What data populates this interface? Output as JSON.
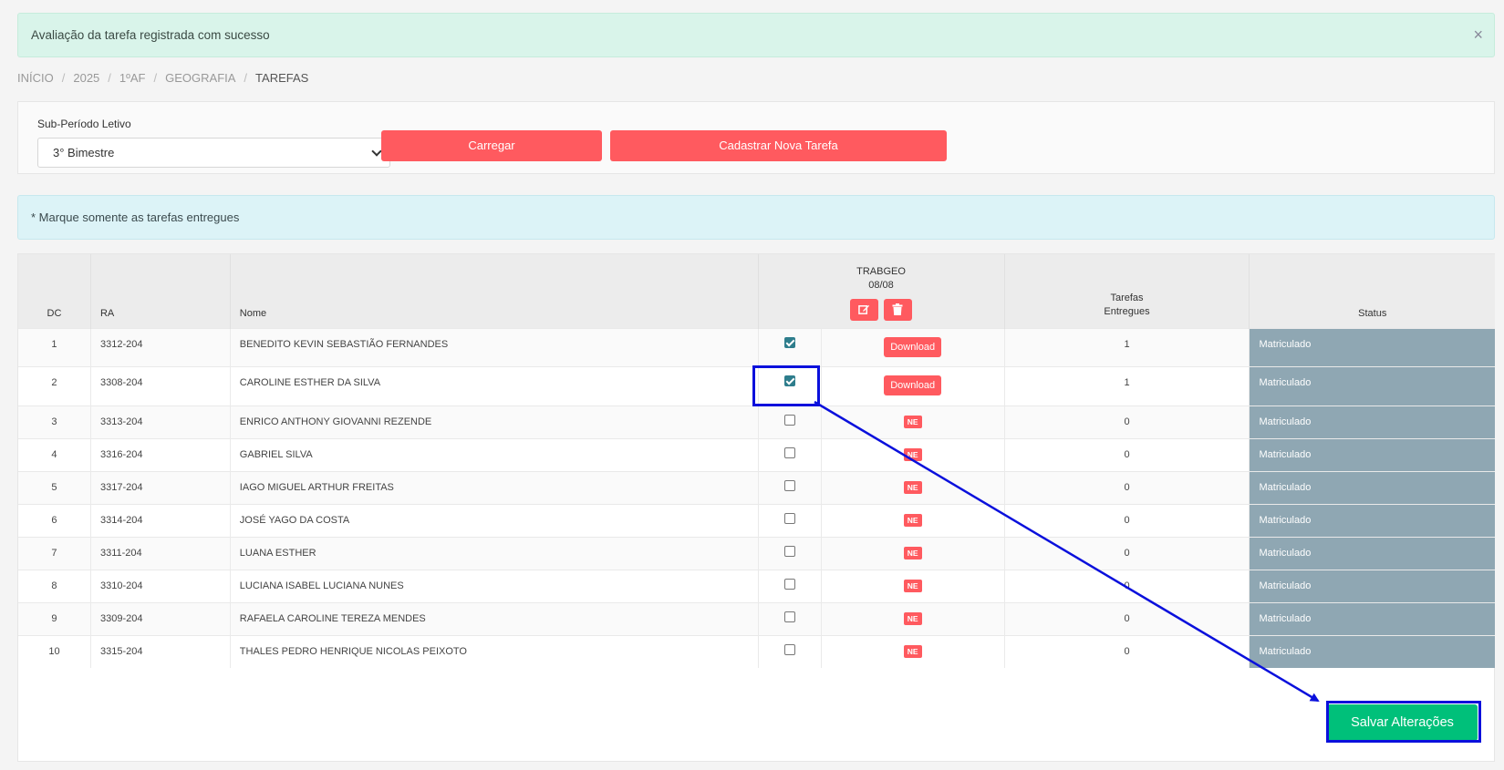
{
  "alert": {
    "message": "Avaliação da tarefa registrada com sucesso",
    "close": "×"
  },
  "breadcrumb": [
    "INÍCIO",
    "2025",
    "1ºAF",
    "GEOGRAFIA",
    "TAREFAS"
  ],
  "filter": {
    "label": "Sub-Período Letivo",
    "selected": "3° Bimestre",
    "load_button": "Carregar",
    "new_task_button": "Cadastrar Nova Tarefa"
  },
  "info": {
    "message": "* Marque somente as tarefas entregues"
  },
  "table": {
    "headers": {
      "dc": "DC",
      "ra": "RA",
      "nome": "Nome",
      "task_name": "TRABGEO",
      "task_date": "08/08",
      "delivered_line1": "Tarefas",
      "delivered_line2": "Entregues",
      "status": "Status"
    },
    "rows": [
      {
        "dc": "1",
        "ra": "3312-204",
        "nome": "BENEDITO KEVIN SEBASTIÃO FERNANDES",
        "checked": true,
        "file": "Download",
        "delivered": "1",
        "status": "Matriculado"
      },
      {
        "dc": "2",
        "ra": "3308-204",
        "nome": "CAROLINE ESTHER DA SILVA",
        "checked": true,
        "file": "Download",
        "delivered": "1",
        "status": "Matriculado"
      },
      {
        "dc": "3",
        "ra": "3313-204",
        "nome": "ENRICO ANTHONY GIOVANNI REZENDE",
        "checked": false,
        "file": "NE",
        "delivered": "0",
        "status": "Matriculado"
      },
      {
        "dc": "4",
        "ra": "3316-204",
        "nome": "GABRIEL SILVA",
        "checked": false,
        "file": "NE",
        "delivered": "0",
        "status": "Matriculado"
      },
      {
        "dc": "5",
        "ra": "3317-204",
        "nome": "IAGO MIGUEL ARTHUR FREITAS",
        "checked": false,
        "file": "NE",
        "delivered": "0",
        "status": "Matriculado"
      },
      {
        "dc": "6",
        "ra": "3314-204",
        "nome": "JOSÉ YAGO DA COSTA",
        "checked": false,
        "file": "NE",
        "delivered": "0",
        "status": "Matriculado"
      },
      {
        "dc": "7",
        "ra": "3311-204",
        "nome": "LUANA ESTHER",
        "checked": false,
        "file": "NE",
        "delivered": "0",
        "status": "Matriculado"
      },
      {
        "dc": "8",
        "ra": "3310-204",
        "nome": "LUCIANA ISABEL LUCIANA NUNES",
        "checked": false,
        "file": "NE",
        "delivered": "0",
        "status": "Matriculado"
      },
      {
        "dc": "9",
        "ra": "3309-204",
        "nome": "RAFAELA CAROLINE TEREZA MENDES",
        "checked": false,
        "file": "NE",
        "delivered": "0",
        "status": "Matriculado"
      },
      {
        "dc": "10",
        "ra": "3315-204",
        "nome": "THALES PEDRO HENRIQUE NICOLAS PEIXOTO",
        "checked": false,
        "file": "NE",
        "delivered": "0",
        "status": "Matriculado"
      }
    ]
  },
  "save_button": "Salvar Alterações",
  "colors": {
    "brand_red": "#ff5a5f",
    "save_green": "#00c07a",
    "status_gray": "#8fa7b3",
    "annotation_blue": "#0a10dc"
  },
  "icons": {
    "edit": "edit-icon",
    "delete": "trash-icon",
    "close": "close-icon"
  }
}
